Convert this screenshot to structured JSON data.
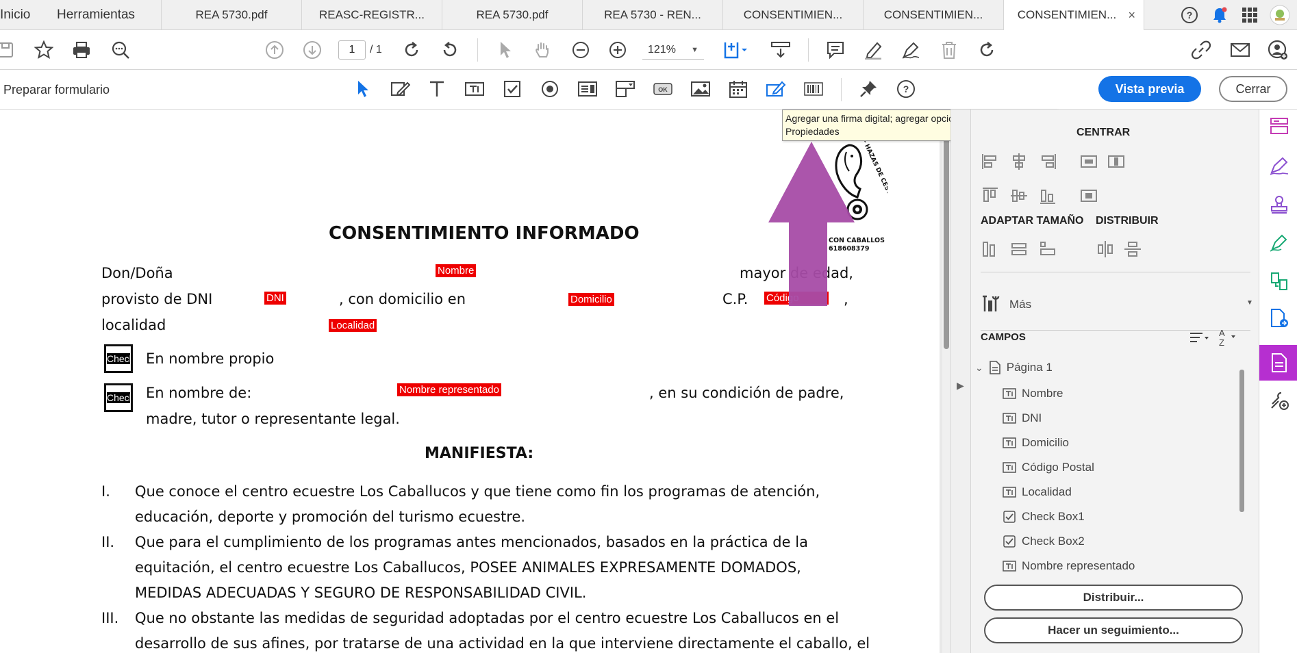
{
  "tabs": {
    "home": "Inicio",
    "tools": "Herramientas",
    "documents": [
      {
        "label": "REA 5730.pdf",
        "active": false
      },
      {
        "label": "REASC-REGISTR...",
        "active": false
      },
      {
        "label": "REA 5730.pdf",
        "active": false
      },
      {
        "label": "REA 5730 - REN...",
        "active": false
      },
      {
        "label": "CONSENTIMIEN...",
        "active": false
      },
      {
        "label": "CONSENTIMIEN...",
        "active": false
      },
      {
        "label": "CONSENTIMIEN...",
        "active": true
      }
    ],
    "close_glyph": "×"
  },
  "toolbar": {
    "page_current": "1",
    "page_total": "/ 1",
    "zoom": "121%"
  },
  "formbar": {
    "title": "Preparar formulario",
    "preview_label": "Vista previa",
    "close_label": "Cerrar"
  },
  "tooltip": {
    "text": "Agregar una firma digital; agregar opciones de firma en la vista Propiedades"
  },
  "document": {
    "title": "CONSENTIMIENTO INFORMADO",
    "line1_start": "Don/Doña",
    "line1_end": "mayor de edad,",
    "line2_dni": "provisto de DNI",
    "line2_dom": ", con domicilio en",
    "line2_cp": "C.P.",
    "line2_comma": ",",
    "line3": "localidad",
    "check1_text": "En nombre propio",
    "check2_text": "En nombre de:",
    "check2_end": ", en su condición de padre,",
    "check2_line2": "madre, tutor o representante legal.",
    "manifiesta": "MANIFIESTA:",
    "items": [
      {
        "num": "I.",
        "lines": [
          "Que conoce el centro ecuestre Los Caballucos y que tiene como fin los programas de atención,",
          "educación, deporte y promoción del turismo ecuestre."
        ]
      },
      {
        "num": "II.",
        "lines": [
          "Que para el cumplimiento de los programas antes mencionados, basados en la práctica de la",
          "equitación, el centro ecuestre Los Caballucos, POSEE ANIMALES EXPRESAMENTE DOMADOS,",
          "MEDIDAS ADECUADAS Y SEGURO DE RESPONSABILIDAD CIVIL."
        ]
      },
      {
        "num": "III.",
        "lines": [
          "Que no obstante las medidas de seguridad adoptadas por el centro ecuestre Los Caballucos en el",
          "desarrollo de sus afines, por tratarse de una actividad en la que interviene directamente el caballo, el"
        ]
      }
    ],
    "fields": {
      "nombre": "Nombre",
      "dni": "DNI",
      "domicilio": "Domicilio",
      "codigo": "Código",
      "localidad": "Localidad",
      "nombre_rep": "Nombre representado",
      "check": "Checl"
    },
    "logo": {
      "text_top": "LOS CABALLUCOS - HAZAS DE CESTO",
      "text_bottom": "CON CABALLOS",
      "phone": "618608379"
    }
  },
  "panel": {
    "centrar": "CENTRAR",
    "adaptar": "ADAPTAR TAMAÑO",
    "distribuir": "DISTRIBUIR",
    "mas": "Más",
    "campos": "CAMPOS",
    "page_node": "Página 1",
    "fields": [
      {
        "name": "Nombre",
        "type": "text"
      },
      {
        "name": "DNI",
        "type": "text"
      },
      {
        "name": "Domicilio",
        "type": "text"
      },
      {
        "name": "Código Postal",
        "type": "text"
      },
      {
        "name": "Localidad",
        "type": "text"
      },
      {
        "name": "Check Box1",
        "type": "check"
      },
      {
        "name": "Check Box2",
        "type": "check"
      },
      {
        "name": "Nombre representado",
        "type": "text"
      }
    ],
    "btn_distribuir": "Distribuir...",
    "btn_seguimiento": "Hacer un seguimiento..."
  },
  "colors": {
    "accent": "#1473e6",
    "field_red": "#e00000",
    "arrow_purple": "#a64ca6",
    "rail_active": "#b62fd0"
  }
}
